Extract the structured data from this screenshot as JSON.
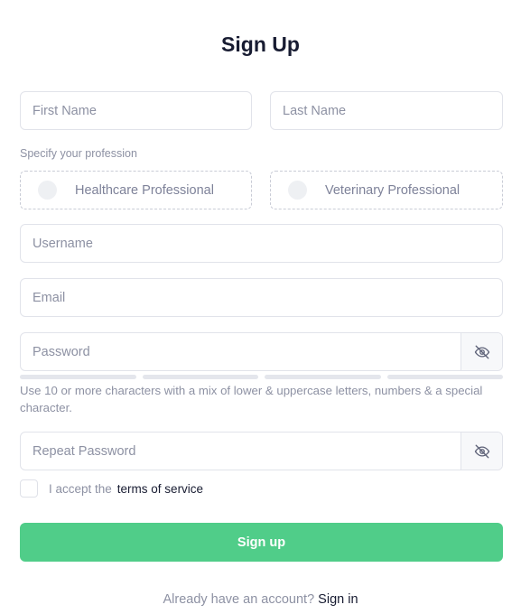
{
  "title": "Sign Up",
  "fields": {
    "first_name": {
      "placeholder": "First Name",
      "value": ""
    },
    "last_name": {
      "placeholder": "Last Name",
      "value": ""
    },
    "username": {
      "placeholder": "Username",
      "value": ""
    },
    "email": {
      "placeholder": "Email",
      "value": ""
    },
    "password": {
      "placeholder": "Password",
      "value": ""
    },
    "repeat_password": {
      "placeholder": "Repeat Password",
      "value": ""
    }
  },
  "profession": {
    "label": "Specify your profession",
    "options": [
      {
        "label": "Healthcare Professional",
        "selected": false
      },
      {
        "label": "Veterinary Professional",
        "selected": false
      }
    ]
  },
  "password_strength": {
    "segments": 4,
    "filled": 0
  },
  "password_hint": "Use 10 or more characters with a mix of lower & uppercase letters, numbers & a special character.",
  "terms": {
    "prefix": "I accept the",
    "link": "terms of service",
    "checked": false
  },
  "submit_label": "Sign up",
  "footer": {
    "text": "Already have an account?",
    "link": "Sign in"
  },
  "colors": {
    "accent": "#50cd89",
    "text_dark": "#181c32",
    "text_muted": "#8d91a3",
    "border": "#e1e3ea"
  },
  "icons": {
    "password_toggle": "eye-slash-icon"
  }
}
